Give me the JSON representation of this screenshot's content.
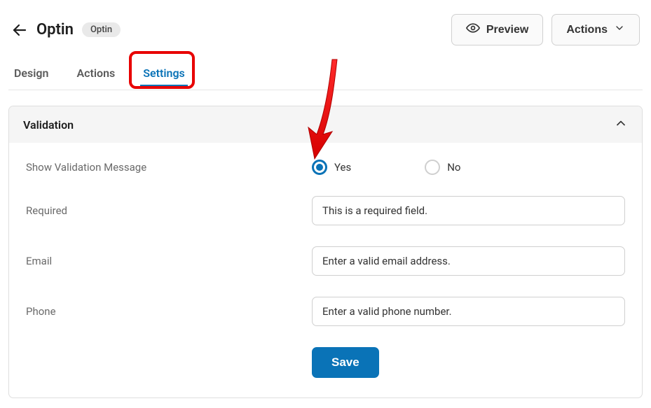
{
  "header": {
    "title": "Optin",
    "tag": "Optin",
    "preview_label": "Preview",
    "actions_label": "Actions"
  },
  "tabs": [
    {
      "id": "design",
      "label": "Design",
      "active": false
    },
    {
      "id": "actions",
      "label": "Actions",
      "active": false
    },
    {
      "id": "settings",
      "label": "Settings",
      "active": true
    }
  ],
  "panel": {
    "title": "Validation",
    "show_validation_label": "Show Validation Message",
    "radio_yes": "Yes",
    "radio_no": "No",
    "required_label": "Required",
    "required_value": "This is a required field.",
    "email_label": "Email",
    "email_value": "Enter a valid email address.",
    "phone_label": "Phone",
    "phone_value": "Enter a valid phone number.",
    "save_label": "Save"
  }
}
